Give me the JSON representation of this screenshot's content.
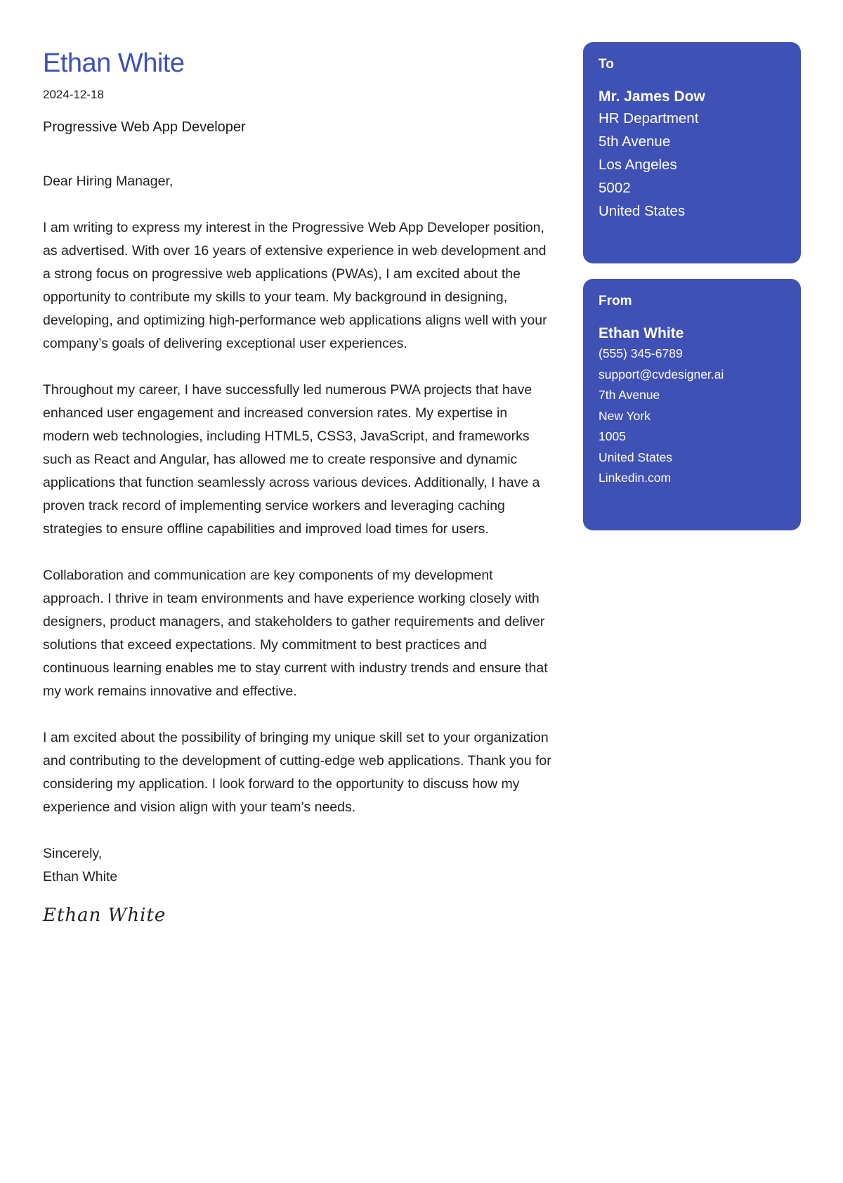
{
  "header": {
    "name": "Ethan White",
    "date": "2024-12-18",
    "job_title": "Progressive Web App Developer"
  },
  "letter": {
    "salutation": "Dear Hiring Manager,",
    "paragraphs": [
      "I am writing to express my interest in the Progressive Web App Developer position, as advertised. With over 16 years of extensive experience in web development and a strong focus on progressive web applications (PWAs), I am excited about the opportunity to contribute my skills to your team. My background in designing, developing, and optimizing high-performance web applications aligns well with your company’s goals of delivering exceptional user experiences.",
      "Throughout my career, I have successfully led numerous PWA projects that have enhanced user engagement and increased conversion rates. My expertise in modern web technologies, including HTML5, CSS3, JavaScript, and frameworks such as React and Angular, has allowed me to create responsive and dynamic applications that function seamlessly across various devices. Additionally, I have a proven track record of implementing service workers and leveraging caching strategies to ensure offline capabilities and improved load times for users.",
      "Collaboration and communication are key components of my development approach. I thrive in team environments and have experience working closely with designers, product managers, and stakeholders to gather requirements and deliver solutions that exceed expectations. My commitment to best practices and continuous learning enables me to stay current with industry trends and ensure that my work remains innovative and effective.",
      "I am excited about the possibility of bringing my unique skill set to your organization and contributing to the development of cutting-edge web applications. Thank you for considering my application. I look forward to the opportunity to discuss how my experience and vision align with your team’s needs."
    ],
    "closing": "Sincerely,",
    "closing_name": "Ethan White",
    "signature": "Ethan White"
  },
  "recipient": {
    "heading": "To",
    "name": "Mr. James Dow",
    "lines": [
      "HR Department",
      "5th Avenue",
      "Los Angeles",
      "5002",
      "United States"
    ]
  },
  "sender": {
    "heading": "From",
    "name": "Ethan White",
    "lines": [
      "(555) 345-6789",
      "support@cvdesigner.ai",
      "7th Avenue",
      "New York",
      "1005",
      "United States",
      "Linkedin.com"
    ]
  },
  "colors": {
    "accent": "#3f51b5",
    "text": "#1a1a1a"
  }
}
